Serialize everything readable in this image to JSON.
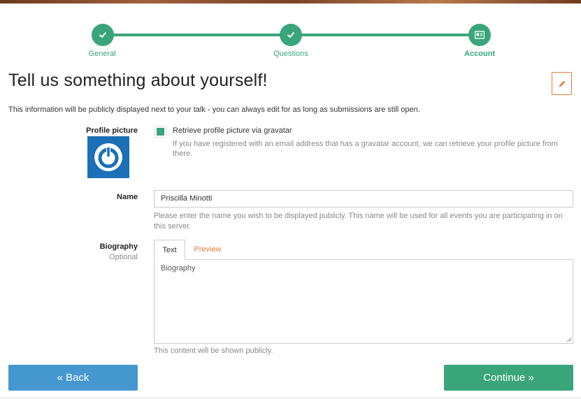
{
  "stepper": {
    "steps": [
      {
        "label": "General",
        "state": "done"
      },
      {
        "label": "Questions",
        "state": "done"
      },
      {
        "label": "Account",
        "state": "current"
      }
    ],
    "accent_color": "#3aa57a"
  },
  "page": {
    "title": "Tell us something about yourself!",
    "intro": "This information will be publicly displayed next to your talk - you can always edit for as long as submissions are still open."
  },
  "profile_picture": {
    "label": "Profile picture",
    "gravatar_label": "Retrieve profile picture via gravatar",
    "gravatar_help": "If you have registered with an email address that has a gravatar account, we can retrieve your profile picture from there.",
    "gravatar_checked": true
  },
  "name": {
    "label": "Name",
    "value": "Priscilla Minotti",
    "help": "Please enter the name you wish to be displayed publicly. This name will be used for all events you are participating in on this server."
  },
  "biography": {
    "label": "Biography",
    "optional": "Optional",
    "tab_text": "Text",
    "tab_preview": "Preview",
    "placeholder": "Biography",
    "help": "This content will be shown publicly."
  },
  "buttons": {
    "back": "« Back",
    "continue": "Continue »"
  },
  "colors": {
    "success": "#3aa57a",
    "primary": "#4597cf",
    "link": "#e07b39",
    "avatar_bg": "#1b70b7"
  },
  "icons": {
    "step_done": "check-icon",
    "step_current": "id-card-icon",
    "edit": "pencil-icon",
    "avatar": "power-icon"
  }
}
